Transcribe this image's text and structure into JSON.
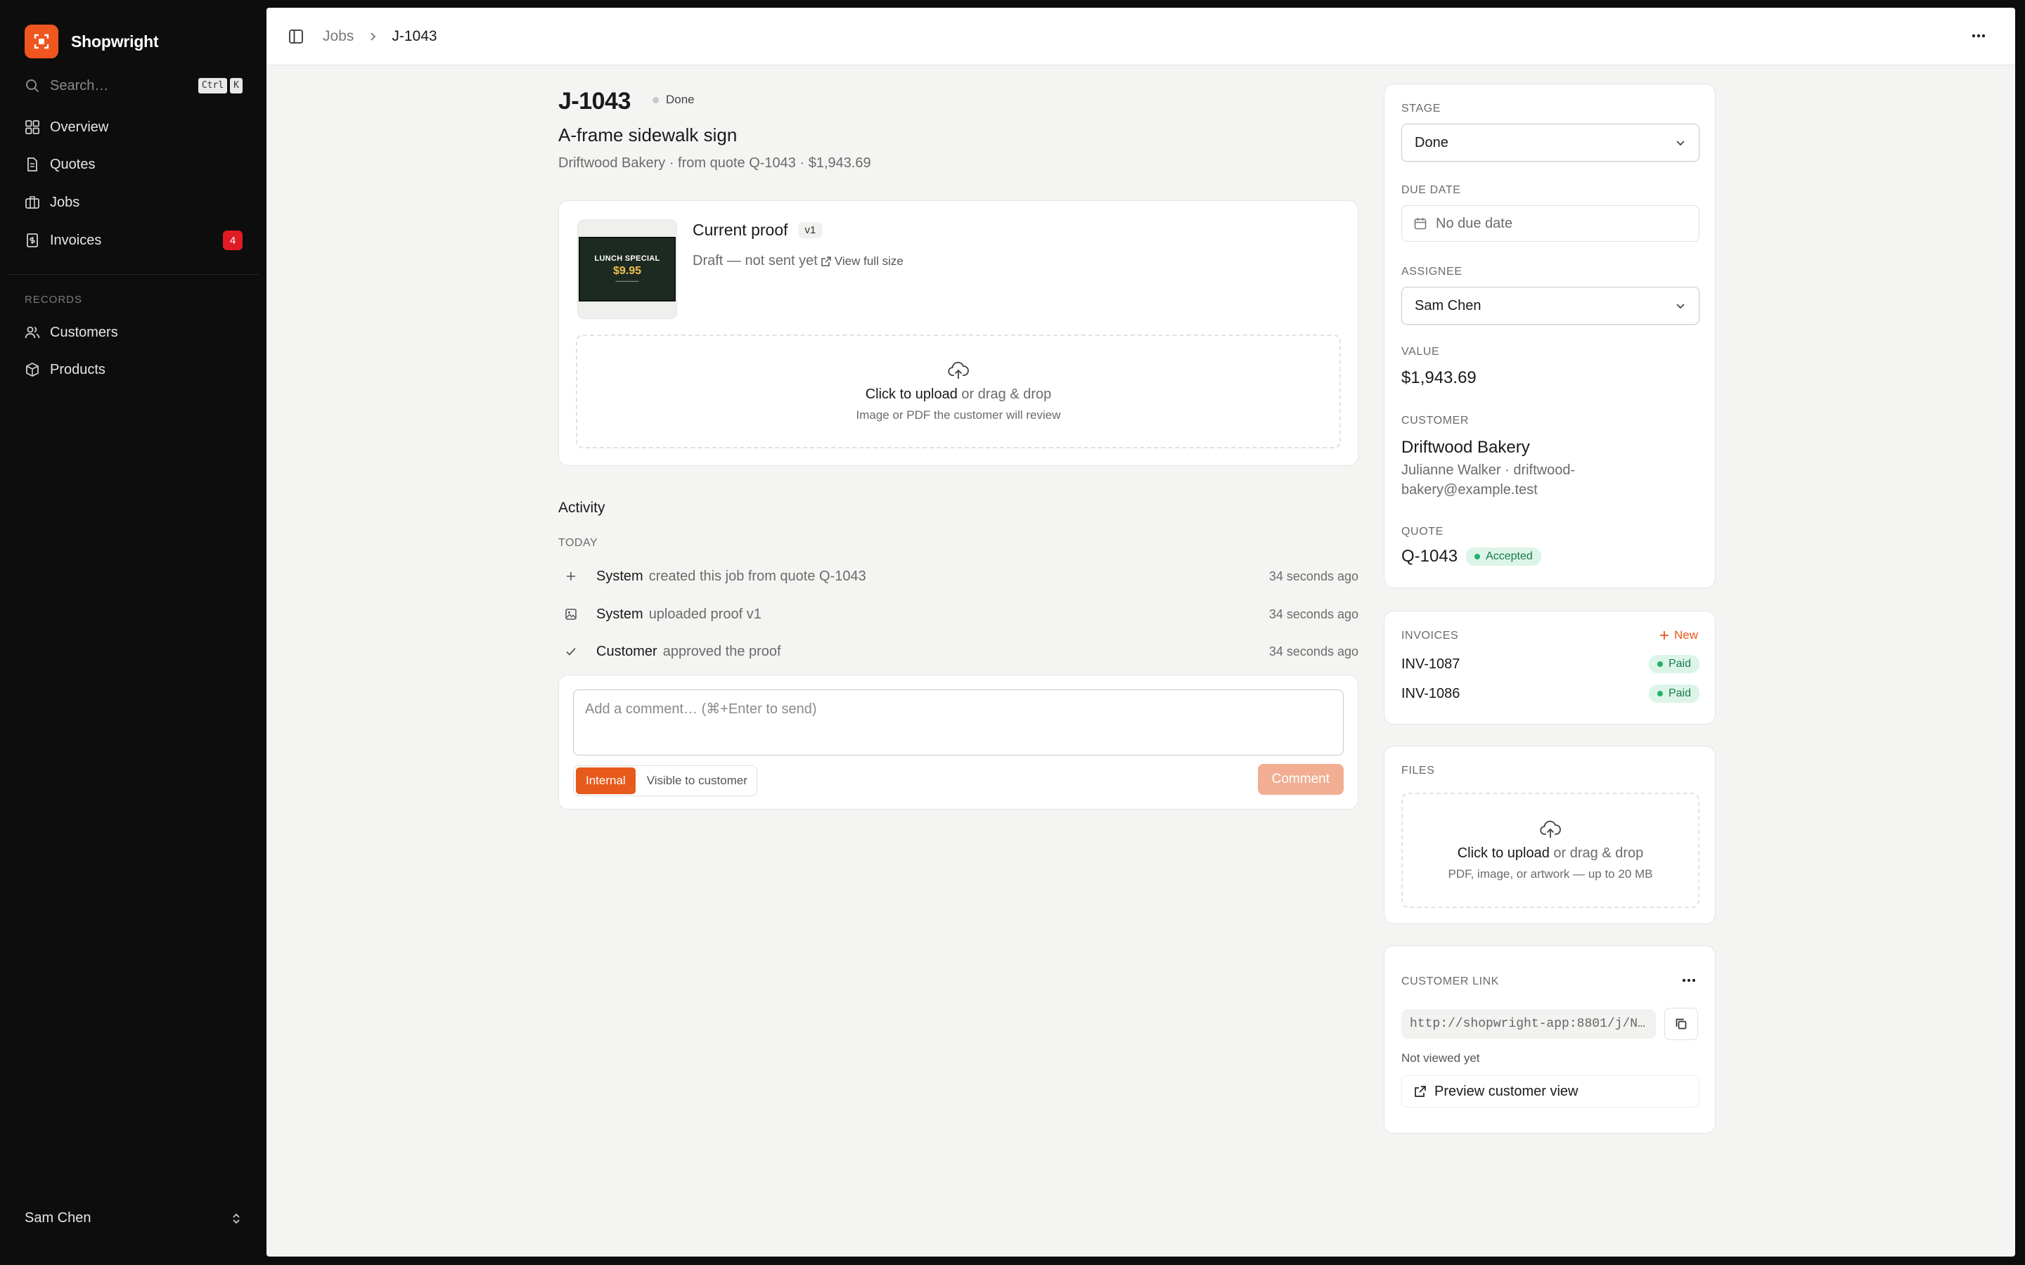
{
  "sidebar": {
    "brand": "Shopwright",
    "search_placeholder": "Search…",
    "shortcut": [
      "Ctrl",
      "K"
    ],
    "nav": [
      {
        "label": "Overview"
      },
      {
        "label": "Quotes"
      },
      {
        "label": "Jobs"
      },
      {
        "label": "Invoices",
        "badge": "4"
      }
    ],
    "records_label": "RECORDS",
    "records": [
      {
        "label": "Customers"
      },
      {
        "label": "Products"
      }
    ],
    "user": "Sam Chen"
  },
  "topbar": {
    "breadcrumb": [
      "Jobs",
      "J-1043"
    ]
  },
  "job": {
    "id": "J-1043",
    "status": "Done",
    "name": "A-frame sidewalk sign",
    "meta": "Driftwood Bakery · from quote Q-1043 · $1,943.69"
  },
  "proof": {
    "title": "Current proof",
    "version": "v1",
    "status": "Draft — not sent yet",
    "view_full": "View full size",
    "thumb": {
      "line1": "LUNCH SPECIAL",
      "line2": "$9.95"
    },
    "upload_strong": "Click to upload",
    "upload_rest": " or drag & drop",
    "upload_hint": "Image or PDF the customer will review"
  },
  "activity": {
    "heading": "Activity",
    "group": "TODAY",
    "items": [
      {
        "who": "System",
        "text": "created this job from quote Q-1043",
        "time": "34 seconds ago",
        "icon": "plus-icon"
      },
      {
        "who": "System",
        "text": "uploaded proof v1",
        "time": "34 seconds ago",
        "icon": "image-icon"
      },
      {
        "who": "Customer",
        "text": "approved the proof",
        "time": "34 seconds ago",
        "icon": "check-icon"
      }
    ]
  },
  "comment": {
    "placeholder": "Add a comment… (⌘+Enter to send)",
    "internal": "Internal",
    "visible": "Visible to customer",
    "button": "Comment"
  },
  "details": {
    "stage_label": "STAGE",
    "stage_value": "Done",
    "due_label": "DUE DATE",
    "due_value": "No due date",
    "assignee_label": "ASSIGNEE",
    "assignee_value": "Sam Chen",
    "value_label": "VALUE",
    "value": "$1,943.69",
    "customer_label": "CUSTOMER",
    "customer_name": "Driftwood Bakery",
    "customer_contact_1": "Julianne Walker · driftwood-",
    "customer_contact_2": "bakery@example.test",
    "quote_label": "QUOTE",
    "quote_id": "Q-1043",
    "quote_status": "Accepted"
  },
  "invoices": {
    "label": "INVOICES",
    "new_label": "New",
    "items": [
      {
        "id": "INV-1087",
        "status": "Paid"
      },
      {
        "id": "INV-1086",
        "status": "Paid"
      }
    ]
  },
  "files": {
    "label": "FILES",
    "upload_strong": "Click to upload",
    "upload_rest": " or drag & drop",
    "upload_hint": "PDF, image, or artwork — up to 20 MB"
  },
  "customer_link": {
    "label": "CUSTOMER LINK",
    "url": "http://shopwright-app:8801/j/N…",
    "viewed": "Not viewed yet",
    "preview": "Preview customer view"
  },
  "colors": {
    "accent": "#e85a1b",
    "brand": "#f0561f",
    "badge": "#e01b24",
    "success": "#23b26a"
  }
}
